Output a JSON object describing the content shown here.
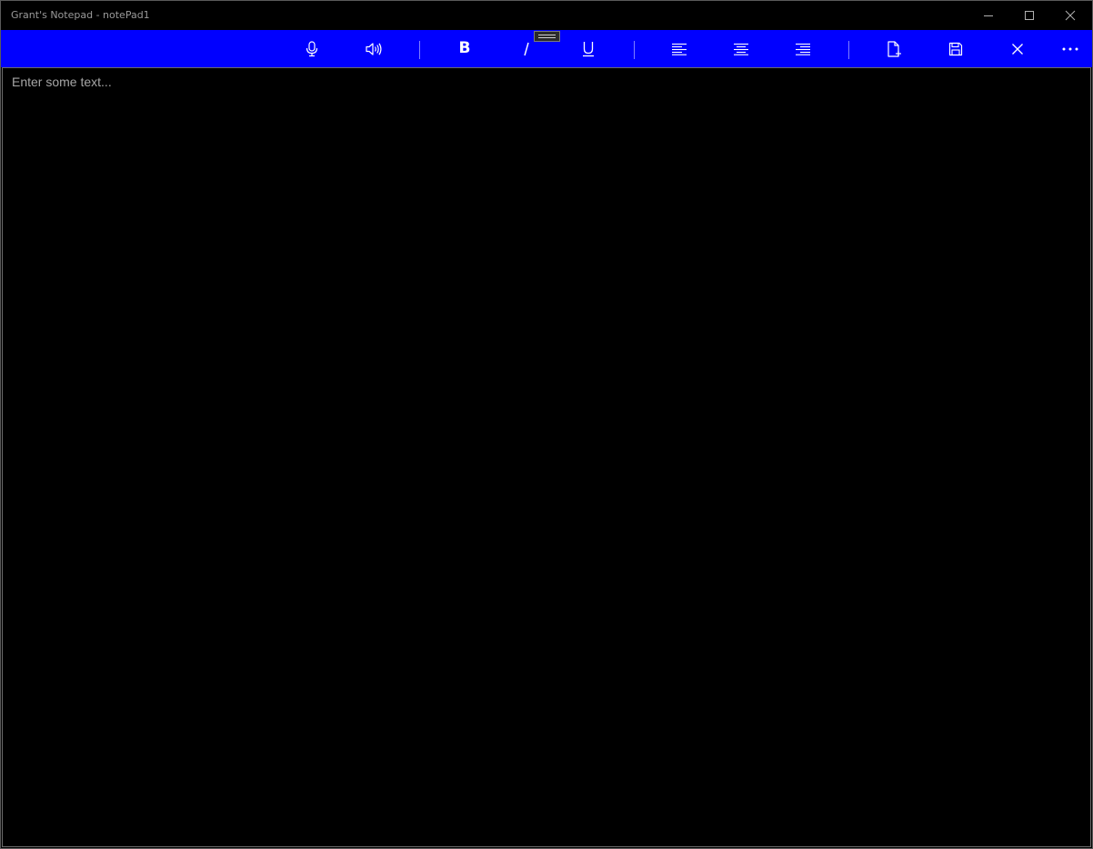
{
  "window": {
    "title": "Grant's Notepad - notePad1"
  },
  "caption_buttons": {
    "minimize": "minimize-icon",
    "maximize": "maximize-icon",
    "close": "close-icon"
  },
  "toolbar": {
    "accent_color": "#0000ff",
    "buttons": [
      {
        "id": "dictate",
        "icon": "microphone-icon"
      },
      {
        "id": "read-aloud",
        "icon": "speaker-icon"
      },
      {
        "id": "bold",
        "icon": "bold-icon",
        "glyph": "B"
      },
      {
        "id": "italic",
        "icon": "italic-icon"
      },
      {
        "id": "underline",
        "icon": "underline-icon"
      },
      {
        "id": "align-left",
        "icon": "align-left-icon"
      },
      {
        "id": "align-center",
        "icon": "align-center-icon"
      },
      {
        "id": "align-right",
        "icon": "align-right-icon"
      },
      {
        "id": "new",
        "icon": "new-document-icon"
      },
      {
        "id": "save",
        "icon": "save-icon"
      },
      {
        "id": "close-document",
        "icon": "close-icon"
      },
      {
        "id": "more",
        "icon": "more-icon"
      }
    ]
  },
  "editor": {
    "placeholder": "Enter some text...",
    "value": ""
  }
}
